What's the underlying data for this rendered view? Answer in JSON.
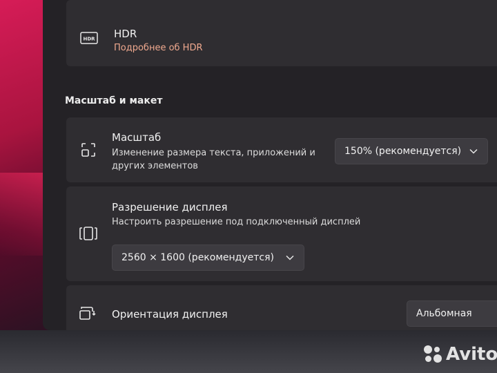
{
  "hdr": {
    "title": "HDR",
    "link": "Подробнее об HDR",
    "icon": "hdr-icon"
  },
  "section": {
    "title": "Масштаб и макет"
  },
  "scale": {
    "title": "Масштаб",
    "desc_line1": "Изменение размера текста, приложений и",
    "desc_line2": "других элементов",
    "value": "150% (рекомендуется)",
    "icon": "scale-icon"
  },
  "resolution": {
    "title": "Разрешение дисплея",
    "desc": "Настроить разрешение под подключенный дисплей",
    "value": "2560 × 1600 (рекомендуется)",
    "icon": "resolution-icon"
  },
  "orientation": {
    "title": "Ориентация дисплея",
    "value": "Альбомная",
    "icon": "orientation-icon"
  },
  "watermark": {
    "text": "Avito"
  },
  "colors": {
    "accent_link": "#f0a98f",
    "card": "#2f2d31",
    "window": "#242226"
  }
}
